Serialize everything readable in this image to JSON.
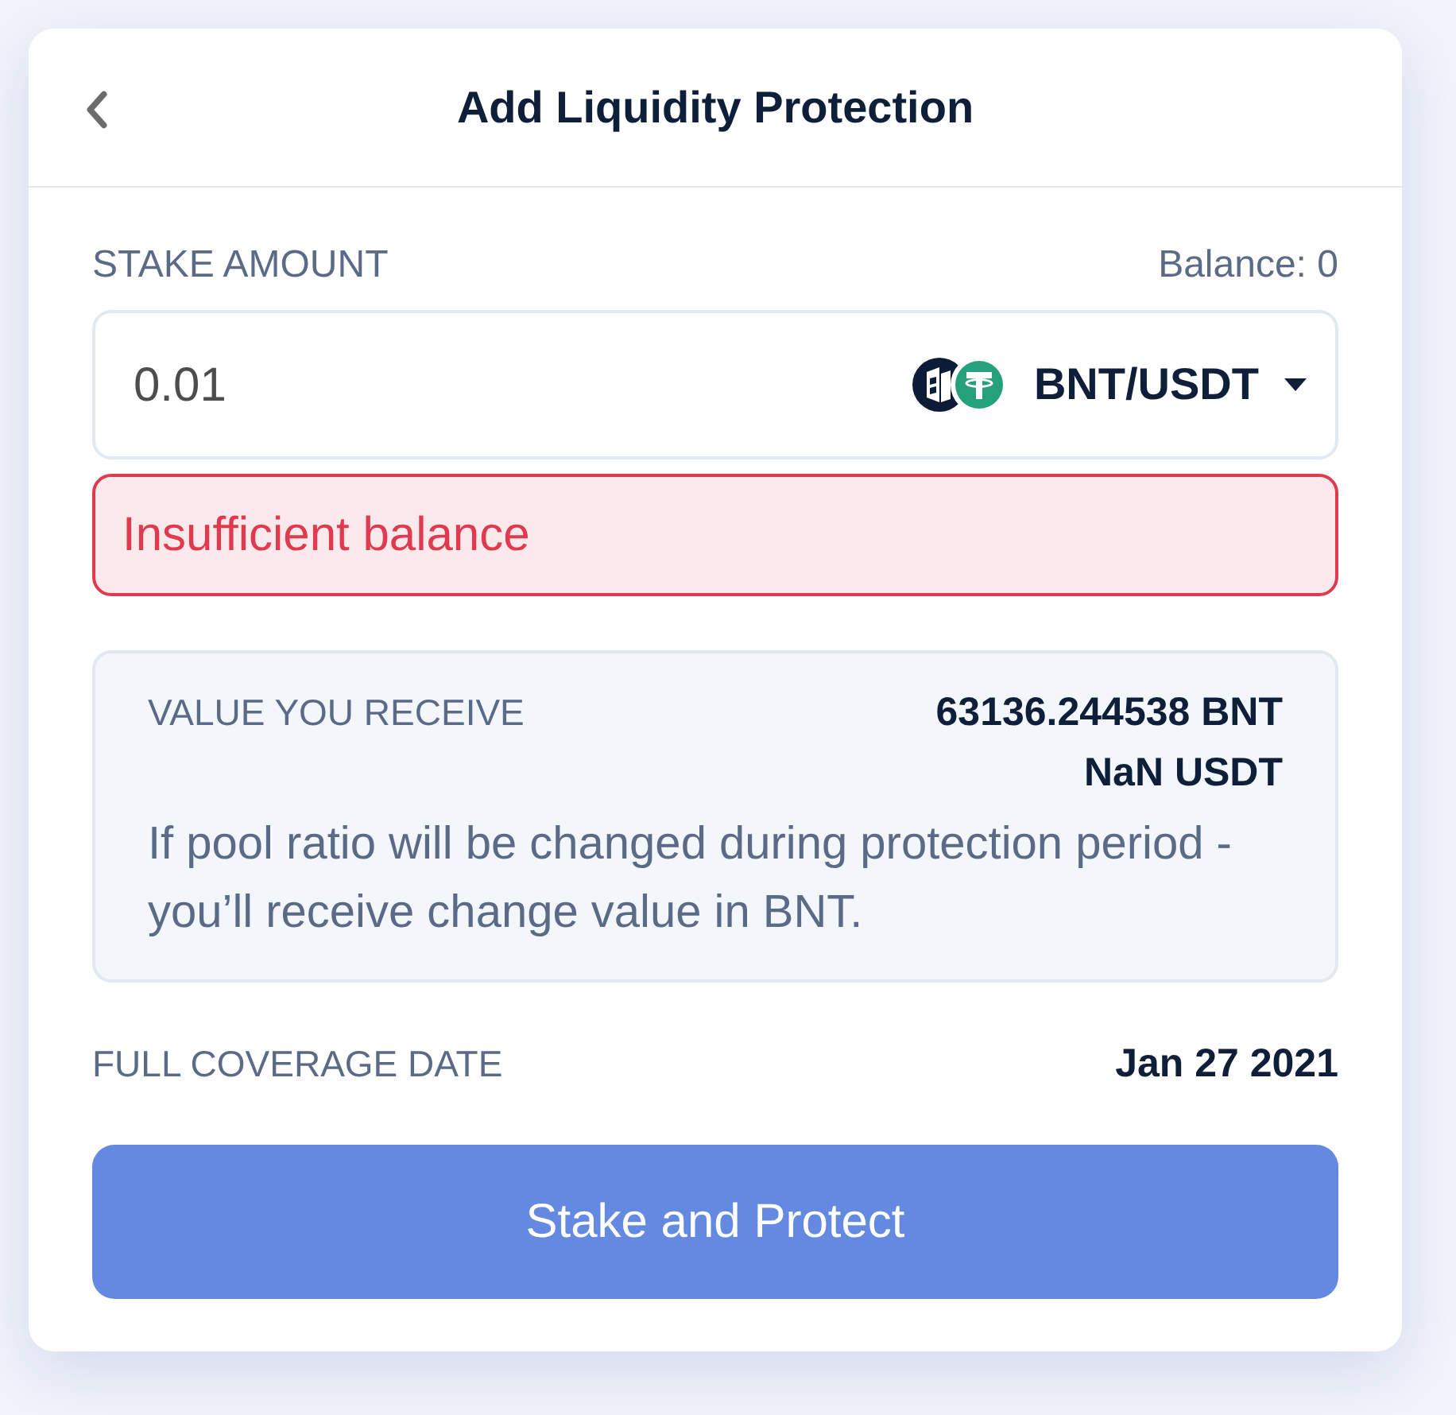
{
  "header": {
    "title": "Add Liquidity Protection"
  },
  "stake": {
    "label": "STAKE AMOUNT",
    "balance": "Balance: 0",
    "amount": "0.01",
    "pair": "BNT/USDT",
    "error": "Insufficient balance"
  },
  "receive": {
    "label": "VALUE YOU RECEIVE",
    "values": [
      "63136.244538 BNT",
      "NaN USDT"
    ],
    "note": "If pool ratio will be changed during protection period - you’ll receive change value in BNT."
  },
  "coverage": {
    "label": "FULL COVERAGE DATE",
    "date": "Jan 27 2021"
  },
  "submit": {
    "label": "Stake and Protect"
  }
}
